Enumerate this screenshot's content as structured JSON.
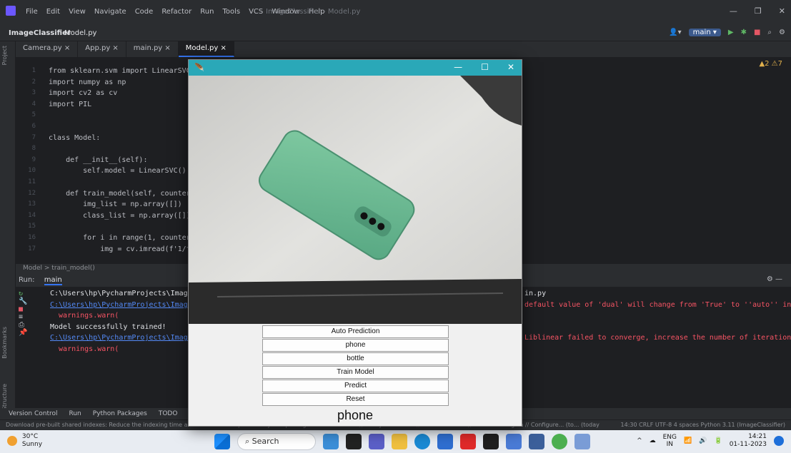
{
  "ide": {
    "menus": [
      "File",
      "Edit",
      "View",
      "Navigate",
      "Code",
      "Refactor",
      "Run",
      "Tools",
      "VCS",
      "Window",
      "Help"
    ],
    "window_title": "ImageClassifier - Model.py",
    "project": "ImageClassifier",
    "current_file": "Model.py",
    "branch": "main",
    "tabs": [
      "Camera.py",
      "App.py",
      "main.py",
      "Model.py"
    ],
    "warnings": "▲2 ⚠7",
    "code_lines": [
      {
        "n": "1",
        "t": "from sklearn.svm import LinearSVC"
      },
      {
        "n": "2",
        "t": "import numpy as np"
      },
      {
        "n": "3",
        "t": "import cv2 as cv"
      },
      {
        "n": "4",
        "t": "import PIL"
      },
      {
        "n": "5",
        "t": ""
      },
      {
        "n": "6",
        "t": ""
      },
      {
        "n": "7",
        "t": "class Model:"
      },
      {
        "n": "8",
        "t": ""
      },
      {
        "n": "9",
        "t": "    def __init__(self):"
      },
      {
        "n": "10",
        "t": "        self.model = LinearSVC()"
      },
      {
        "n": "11",
        "t": ""
      },
      {
        "n": "12",
        "t": "    def train_model(self, counters"
      },
      {
        "n": "13",
        "t": "        img_list = np.array([])"
      },
      {
        "n": "14",
        "t": "        class_list = np.array([])"
      },
      {
        "n": "15",
        "t": ""
      },
      {
        "n": "16",
        "t": "        for i in range(1, counters"
      },
      {
        "n": "17",
        "t": "            img = cv.imread(f'1/fr"
      }
    ],
    "breadcrumb": "Model  >  train_model()",
    "run_label": "Run:",
    "run_config": "main",
    "console": [
      {
        "t": "C:\\Users\\hp\\PycharmProjects\\Image",
        "c": "cwhite"
      },
      {
        "t": "C:\\Users\\hp\\PycharmProjects\\Image",
        "c": "clink"
      },
      {
        "t": "  warnings.warn(",
        "c": "cred"
      },
      {
        "t": "Model successfully trained!",
        "c": "cwhite"
      },
      {
        "t": "C:\\Users\\hp\\PycharmProjects\\Image",
        "c": "clink"
      },
      {
        "t": "  warnings.warn(",
        "c": "cred"
      }
    ],
    "console_right": [
      {
        "t": "in.py",
        "c": "cwhite"
      },
      {
        "t": "default value of 'dual' will change from 'True' to ''auto'' in 1",
        "c": "cred"
      },
      {
        "t": "",
        "c": "cred"
      },
      {
        "t": "",
        "c": "cred"
      },
      {
        "t": "Liblinear failed to converge, increase the number of iterations.",
        "c": "cred"
      }
    ],
    "bottom_tools": [
      "Version Control",
      "Run",
      "Python Packages",
      "TODO"
    ],
    "status_msg": "Download pre-built shared indexes: Reduce the indexing time and CPU load with pre-built Python packages shared indexes // Always download // Download once // Don't show again // Configure... (to... (today",
    "status_right": "14:30  CRLF  UTF-8  4 spaces  Python 3.11 (ImageClassifier)"
  },
  "tk": {
    "buttons": [
      "Auto Prediction",
      "phone",
      "bottle",
      "Train Model",
      "Predict",
      "Reset"
    ],
    "result": "phone"
  },
  "taskbar": {
    "temp": "30°C",
    "weather": "Sunny",
    "search": "Search",
    "lang1": "ENG",
    "lang2": "IN",
    "time": "14:21",
    "date": "01-11-2023"
  }
}
